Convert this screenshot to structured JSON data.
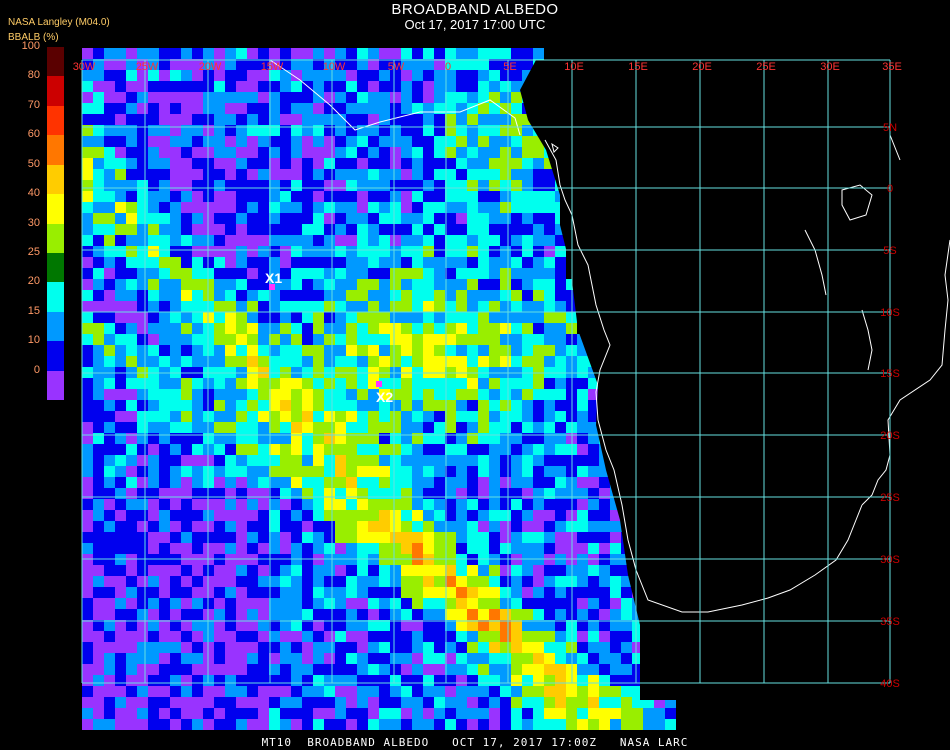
{
  "header": {
    "title": "BROADBAND ALBEDO",
    "subtitle": "Oct 17, 2017 17:00 UTC",
    "source": "NASA Langley (M04.0)",
    "unit_label": "BBALB (%)"
  },
  "colorbar": {
    "ticks": [
      "100",
      "80",
      "70",
      "60",
      "50",
      "40",
      "30",
      "25",
      "20",
      "15",
      "10",
      "0"
    ],
    "colors": [
      "#5a0000",
      "#cc0000",
      "#ff3300",
      "#ff7700",
      "#ffcc00",
      "#ffff00",
      "#99ee00",
      "#007700",
      "#00ffee",
      "#0099ff",
      "#0000ee",
      "#9933ff"
    ]
  },
  "grid": {
    "lon_labels": [
      "30W",
      "25W",
      "20W",
      "15W",
      "10W",
      "5W",
      "0",
      "5E",
      "10E",
      "15E",
      "20E",
      "25E",
      "30E",
      "35E"
    ],
    "lat_labels": [
      "5N",
      "0",
      "5S",
      "10S",
      "15S",
      "20S",
      "25S",
      "30S",
      "35S",
      "40S"
    ]
  },
  "markers": [
    {
      "label": "X1",
      "color": "#ff33ff"
    },
    {
      "label": "X2",
      "color": "#ff33ff"
    }
  ],
  "footer": {
    "text": "MT10  BROADBAND ALBEDO   OCT 17, 2017 17:00Z   NASA LARC"
  },
  "colors": {
    "grid": "#66e0e0",
    "lon_label": "#ff3333",
    "lat_label": "#cc0000",
    "coast": "#ffffff",
    "background": "#000000"
  }
}
